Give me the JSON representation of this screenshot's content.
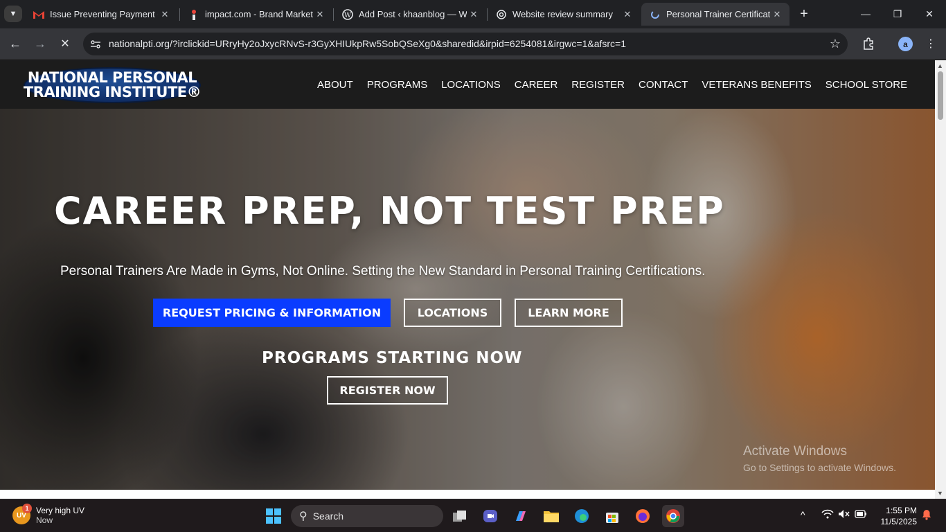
{
  "browser": {
    "tabs": [
      {
        "title": "Issue Preventing Payment - I",
        "favicon": "gmail-icon"
      },
      {
        "title": "impact.com - Brand Marketp",
        "favicon": "impact-icon"
      },
      {
        "title": "Add Post ‹ khaanblog — Wo",
        "favicon": "wordpress-icon"
      },
      {
        "title": "Website review summary",
        "favicon": "chatgpt-icon"
      },
      {
        "title": "Personal Trainer Certificatio",
        "favicon": "loading-icon",
        "active": true
      }
    ],
    "url": "nationalpti.org/?irclickid=URryHy2oJxycRNvS-r3GyXHIUkpRw5SobQSeXg0&sharedid&irpid=6254081&irgwc=1&afsrc=1",
    "profile_initial": "a"
  },
  "site": {
    "logo_line1": "NATIONAL PERSONAL",
    "logo_line2": "TRAINING INSTITUTE®",
    "nav": [
      "ABOUT",
      "PROGRAMS",
      "LOCATIONS",
      "CAREER",
      "REGISTER",
      "CONTACT",
      "VETERANS BENEFITS",
      "SCHOOL STORE"
    ]
  },
  "hero": {
    "title": "CAREER PREP, NOT TEST PREP",
    "subtitle": "Personal Trainers Are Made in Gyms, Not Online. Setting the New Standard in Personal Training Certifications.",
    "btn_request": "REQUEST PRICING & INFORMATION",
    "btn_locations": "LOCATIONS",
    "btn_learn": "LEARN MORE",
    "programs_now": "PROGRAMS STARTING NOW",
    "btn_register": "REGISTER NOW",
    "accent_color": "#0a3cff"
  },
  "watermark": {
    "line1": "Activate Windows",
    "line2": "Go to Settings to activate Windows."
  },
  "taskbar": {
    "weather_badge": "1",
    "weather_uv": "UV",
    "weather_title": "Very high UV",
    "weather_time": "Now",
    "search_label": "Search",
    "time": "1:55 PM",
    "date": "11/5/2025"
  }
}
